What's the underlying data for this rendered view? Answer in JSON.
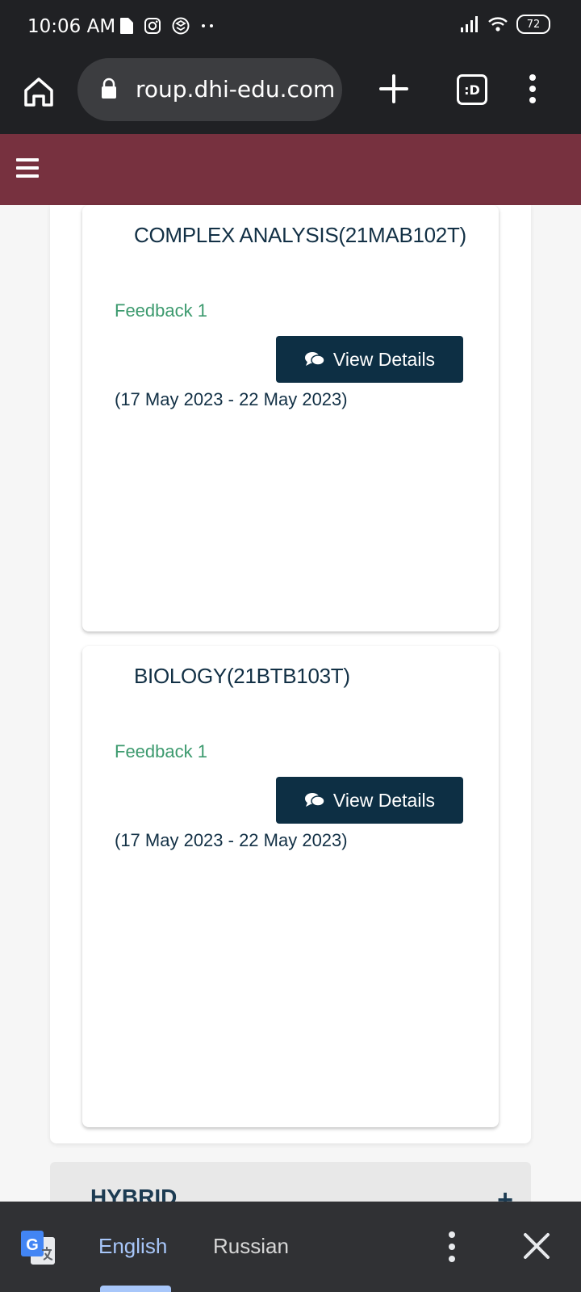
{
  "status_bar": {
    "time": "10:06 AM",
    "battery": "72",
    "icons": [
      "file-icon",
      "instagram-icon",
      "vpn-icon",
      "more-dots-icon",
      "signal-icon",
      "wifi-icon",
      "battery-icon"
    ]
  },
  "browser": {
    "url": "roup.dhi-edu.com",
    "tab_switch_label": ":D"
  },
  "cards": [
    {
      "title": "COMPLEX ANALYSIS(21MAB102T)",
      "feedback": "Feedback 1",
      "button_label": "View Details",
      "date_range": "(17 May 2023 - 22 May 2023)"
    },
    {
      "title": "BIOLOGY(21BTB103T)",
      "feedback": "Feedback 1",
      "button_label": "View Details",
      "date_range": "(17 May 2023 - 22 May 2023)"
    }
  ],
  "section": {
    "title": "HYBRID",
    "toggle": "+"
  },
  "translate_bar": {
    "source_lang": "English",
    "target_lang": "Russian"
  },
  "colors": {
    "app_header": "#77313f",
    "button": "#0d2f44",
    "feedback": "#3c9a6e",
    "active_lang": "#a8c7fa"
  }
}
